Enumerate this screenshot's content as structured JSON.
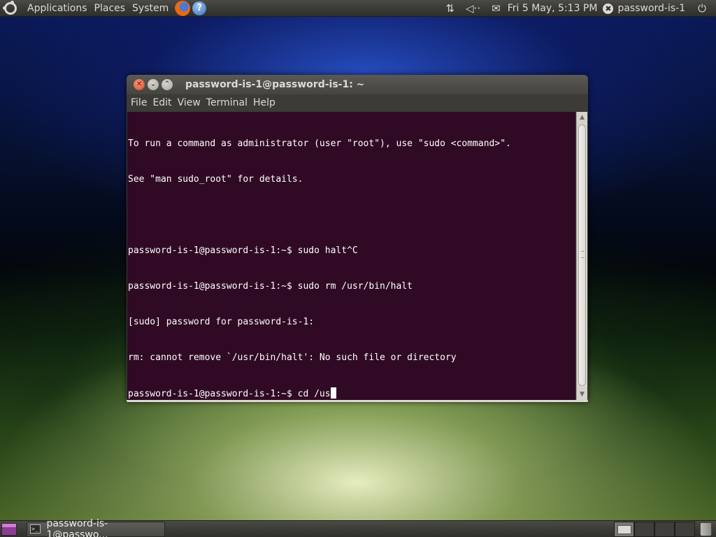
{
  "top_panel": {
    "menus": [
      "Applications",
      "Places",
      "System"
    ],
    "icons": [
      "ubuntu-logo-icon",
      "firefox-icon",
      "help-icon"
    ],
    "help_glyph": "?",
    "tray": {
      "network_glyph": "⇅",
      "volume_glyph": "◁··",
      "mail_glyph": "✉",
      "clock": "Fri  5 May,  5:13 PM",
      "user_x_glyph": "✖",
      "user": "password-is-1",
      "power_glyph": "⏻"
    }
  },
  "terminal": {
    "title": "password-is-1@password-is-1: ~",
    "buttons": {
      "close": "✕",
      "minimize": "⌄",
      "maximize": "⌃"
    },
    "menu": [
      "File",
      "Edit",
      "View",
      "Terminal",
      "Help"
    ],
    "lines": [
      "To run a command as administrator (user \"root\"), use \"sudo <command>\".",
      "See \"man sudo_root\" for details.",
      "",
      "password-is-1@password-is-1:~$ sudo halt^C",
      "password-is-1@password-is-1:~$ sudo rm /usr/bin/halt",
      "[sudo] password for password-is-1:",
      "rm: cannot remove `/usr/bin/halt': No such file or directory"
    ],
    "prompt_line": "password-is-1@password-is-1:~$ cd /us",
    "scroll_up": "▲",
    "scroll_down": "▼"
  },
  "bottom_panel": {
    "task_label": "password-is-1@passwo...",
    "task_icon_glyph": ">_",
    "workspace_count": 4,
    "active_workspace": 1
  }
}
